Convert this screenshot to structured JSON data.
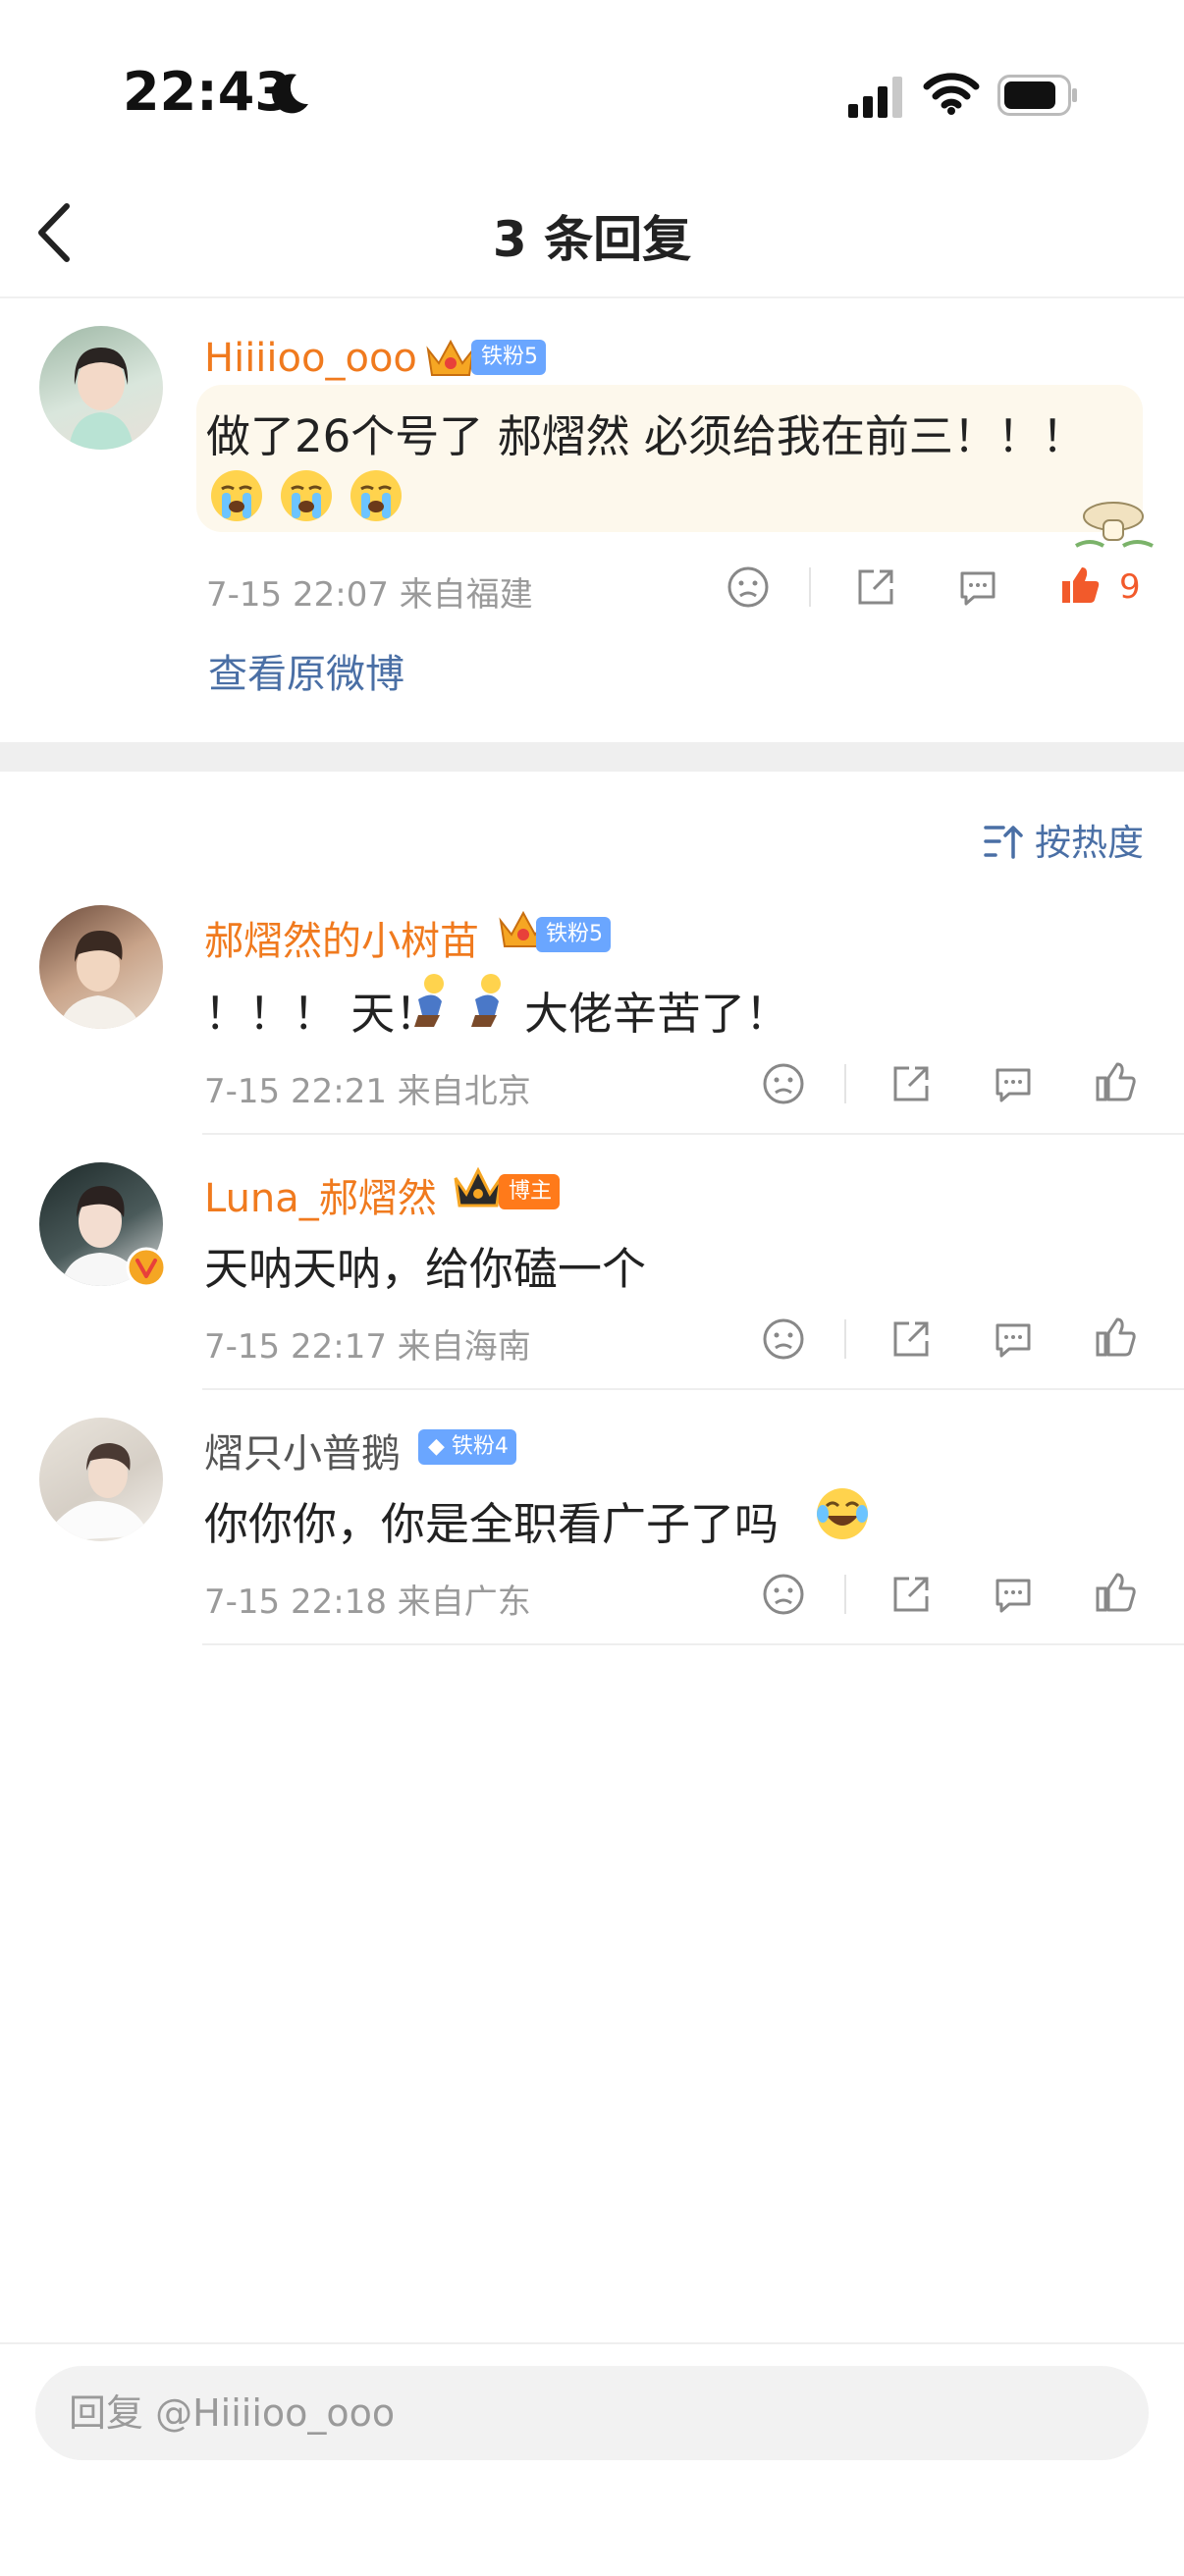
{
  "status_bar": {
    "time": "22:43"
  },
  "nav": {
    "title": "3 条回复"
  },
  "main_comment": {
    "user": "Hiiiioo_ooo",
    "badge": "铁粉5",
    "text": "做了26个号了 郝熠然 必须给我在前三！！！",
    "emoji_count": 3,
    "meta": "7-15 22:07  来自福建",
    "likes": "9",
    "view_original": "查看原微博"
  },
  "sort": {
    "label": "按热度"
  },
  "replies": [
    {
      "user": "郝熠然的小树苗",
      "badge": "铁粉5",
      "text_a": "！！！ 天！",
      "text_b": "大佬辛苦了！",
      "meta": "7-15 22:21  来自北京"
    },
    {
      "user": "Luna_郝熠然",
      "badge": "博主",
      "text": "天呐天呐，给你磕一个",
      "meta": "7-15 22:17  来自海南"
    },
    {
      "user": "熠只小普鹅",
      "badge": "铁粉4",
      "text": "你你你，你是全职看广子了吗",
      "meta": "7-15 22:18  来自广东"
    }
  ],
  "reply_input": {
    "placeholder": "回复 @Hiiiioo_ooo"
  },
  "colors": {
    "accent_orange": "#f07a1e",
    "link_blue": "#4a6fa5",
    "like_red": "#f25a2b"
  }
}
